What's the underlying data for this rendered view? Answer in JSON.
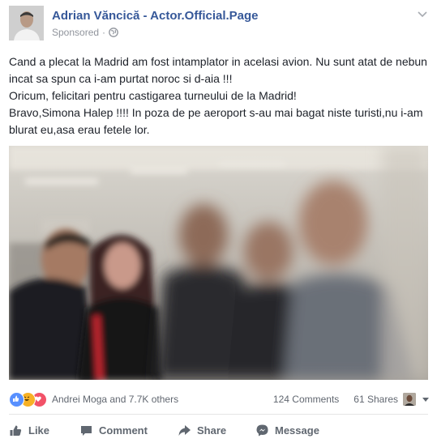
{
  "header": {
    "page_name": "Adrian Văncică - Actor.Official.Page",
    "sponsored": "Sponsored",
    "separator": "·"
  },
  "post": {
    "lines": [
      "Cand a plecat la Madrid am fost intamplator in acelasi avion. Nu sunt atat de nebun incat sa spun ca i-am purtat noroc si d-aia !!!",
      "Oricum, felicitari pentru castigarea turneului de la Madrid!",
      "Bravo,Simona Halep !!!! In poza de pe aeroport s-au mai bagat niste turisti,nu i-am blurat eu,asa erau fetele lor."
    ]
  },
  "reactions": {
    "summary": "Andrei Moga and 7.7K others",
    "types": [
      "like",
      "haha",
      "love"
    ],
    "comments": "124 Comments",
    "shares": "61 Shares"
  },
  "actions": {
    "like": "Like",
    "comment": "Comment",
    "share": "Share",
    "message": "Message"
  },
  "colors": {
    "link": "#365899",
    "muted": "#90949c",
    "action": "#606770",
    "like": "#5890ff",
    "haha": "#f7b125",
    "love": "#f25268"
  }
}
